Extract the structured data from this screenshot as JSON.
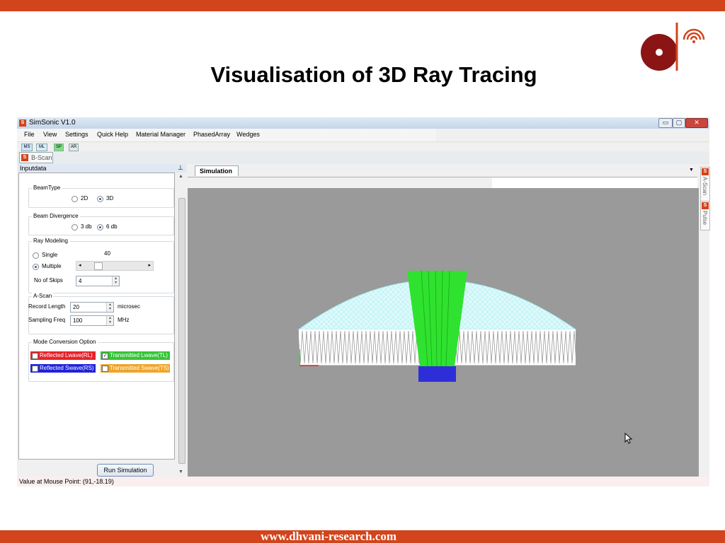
{
  "slide": {
    "title": "Visualisation of 3D Ray Tracing",
    "footer_url": "www.dhvani-research.com",
    "brand_color": "#d2441c",
    "logo_icon": "dhvani-logo-icon"
  },
  "window": {
    "title": "SimSonic V1.0",
    "app_icon": "S",
    "controls": {
      "minimize": "▭",
      "maximize": "▢",
      "close": "✕"
    }
  },
  "menu": {
    "items": [
      "File",
      "View",
      "Settings",
      "Quick Help",
      "Material Manager",
      "PhasedArray",
      "Wedges"
    ]
  },
  "toolbar": {
    "buttons": [
      "MS",
      "ML",
      "SP",
      "AR"
    ]
  },
  "doc_tab": {
    "icon": "S",
    "label": "B-Scan"
  },
  "left_panel": {
    "header": "Inputdata",
    "pin_glyph": "⊥",
    "beam_type": {
      "title": "BeamType",
      "opt_2d": "2D",
      "opt_3d": "3D",
      "selected": "3D"
    },
    "beam_divergence": {
      "title": "Beam Divergence",
      "opt_3db": "3 db",
      "opt_6db": "6 db",
      "selected": "6 db"
    },
    "ray_modeling": {
      "title": "Ray Modeling",
      "opt_single": "Single",
      "opt_multiple": "Multiple",
      "selected": "Multiple",
      "slider_value": "40",
      "skips_label": "No of Skips",
      "skips_value": "4"
    },
    "ascan": {
      "title": "A-Scan",
      "record_length_label": "Record Length",
      "record_length_value": "20",
      "record_length_unit": "microsec",
      "sampling_freq_label": "Sampling Freq",
      "sampling_freq_value": "100",
      "sampling_freq_unit": "MHz"
    },
    "mode_conversion": {
      "title": "Mode Conversion Option",
      "options": [
        {
          "label": "Reflected Lwave(RL)",
          "checked": false,
          "color": "#e8222a"
        },
        {
          "label": "Transmitted Lwave(TL)",
          "checked": true,
          "color": "#35c535"
        },
        {
          "label": "Reflected Swave(RS)",
          "checked": false,
          "color": "#1f23d6"
        },
        {
          "label": "Transmitted Swave(TS)",
          "checked": false,
          "color": "#efa52a"
        }
      ]
    },
    "run_button": "Run Simulation"
  },
  "simulation": {
    "tab_label": "Simulation",
    "right_tabs": [
      {
        "icon": "S",
        "label": "A-Scan"
      },
      {
        "icon": "S",
        "label": "Pulse"
      }
    ],
    "colors": {
      "viewport_bg": "#9a9a9a",
      "dome": "#c8f5f8",
      "beam": "#2fe22f",
      "transducer": "#2e2ed8"
    }
  },
  "status_bar": {
    "text": "Value at Mouse Point: (91,-18.19)"
  }
}
